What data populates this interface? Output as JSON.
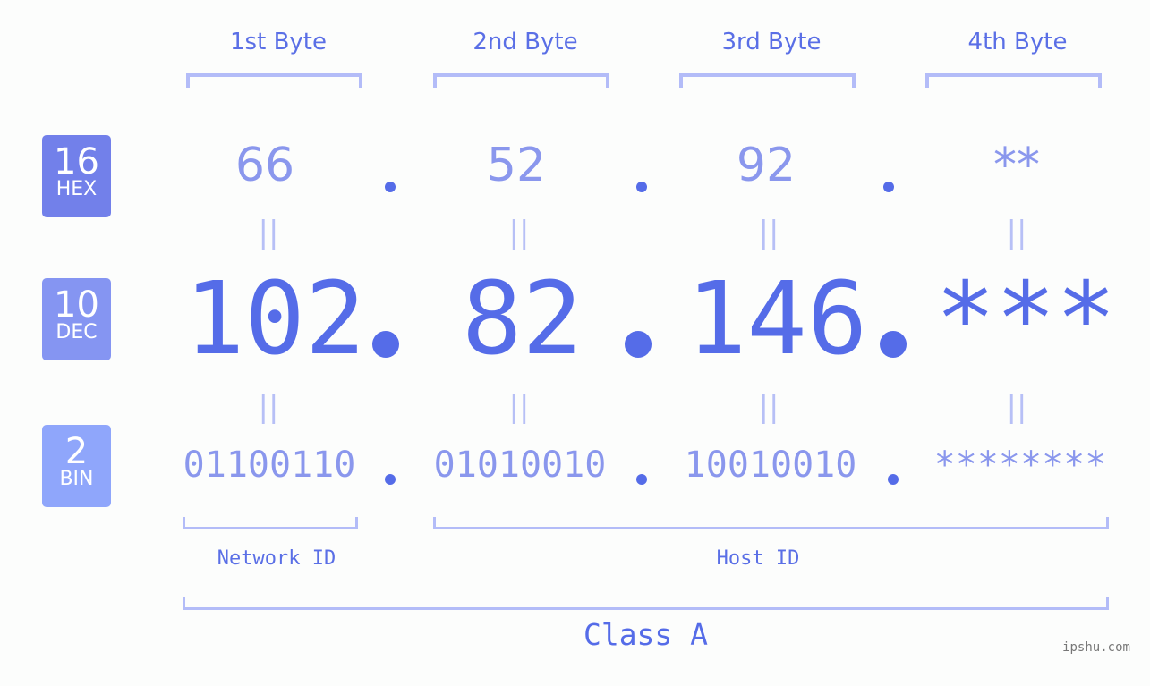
{
  "byte_headers": [
    "1st Byte",
    "2nd Byte",
    "3rd Byte",
    "4th Byte"
  ],
  "badges": [
    {
      "number": "16",
      "label": "HEX",
      "color": "#7280ea"
    },
    {
      "number": "10",
      "label": "DEC",
      "color": "#8595f2"
    },
    {
      "number": "2",
      "label": "BIN",
      "color": "#8fa6fb"
    }
  ],
  "hex": [
    "66",
    "52",
    "92",
    "**"
  ],
  "dec": [
    "102",
    "82",
    "146",
    "***"
  ],
  "bin": [
    "01100110",
    "01010010",
    "10010010",
    "********"
  ],
  "equals": "||",
  "separator": ".",
  "network_id_label": "Network ID",
  "host_id_label": "Host ID",
  "class_label": "Class A",
  "watermark": "ipshu.com",
  "colors": {
    "primary": "#556ce8",
    "light": "#8a97ed",
    "bracket": "#b3bcf8"
  }
}
